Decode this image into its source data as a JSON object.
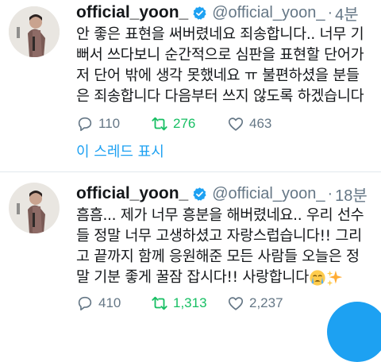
{
  "colors": {
    "accent": "#1da1f2",
    "retweet_active": "#17bf63",
    "secondary_text": "#657786",
    "divider": "#e1e8ed"
  },
  "tweets": [
    {
      "name": "official_yoon_",
      "handle": "@official_yoon_",
      "separator": "·",
      "time": "4분",
      "verified": true,
      "lines": [
        "안 좋은 표현을 써버렸네요 죄송합니다.. 너무 기",
        "뻐서 쓰다보니 순간적으로 심판을 표현할 단어가",
        "저 단어 밖에 생각 못했네요 ㅠ 불편하셨을 분들",
        "은 죄송합니다 다음부터 쓰지 않도록 하겠습니다"
      ],
      "replies": "110",
      "retweets": "276",
      "likes": "463",
      "retweeted": true,
      "show_thread": "이 스레드 표시"
    },
    {
      "name": "official_yoon_",
      "handle": "@official_yoon_",
      "separator": "·",
      "time": "18분",
      "verified": true,
      "lines": [
        "흠흠... 제가 너무 흥분을 해버렸네요.. 우리 선수",
        "들 정말 너무 고생하셨고 자랑스럽습니다!! 그리",
        "고 끝까지 함께 응원해준 모든 사람들 오늘은 정",
        "말 기분 좋게 꿀잠 잡시다!! 사랑합니다"
      ],
      "emojis": [
        "crying-face-emoji",
        "sparkles-emoji"
      ],
      "replies": "410",
      "retweets": "1,313",
      "likes": "2,237",
      "retweeted": true
    }
  ],
  "icons": {
    "reply": "reply-icon",
    "retweet": "retweet-icon",
    "like": "like-icon",
    "verified": "verified-badge-icon",
    "compose": "compose-button"
  }
}
